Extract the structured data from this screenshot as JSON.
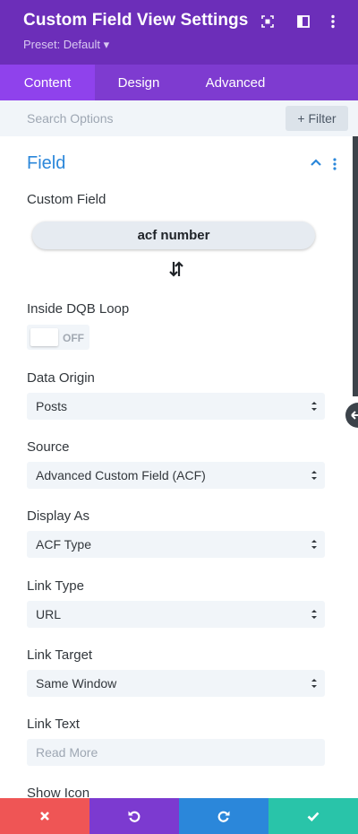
{
  "header": {
    "title": "Custom Field View Settings",
    "preset": "Preset: Default ▾",
    "icons": [
      "fullscreen-icon",
      "sidebar-toggle-icon",
      "more-vertical-icon"
    ]
  },
  "tabs": [
    {
      "label": "Content",
      "active": true
    },
    {
      "label": "Design",
      "active": false
    },
    {
      "label": "Advanced",
      "active": false
    }
  ],
  "search": {
    "placeholder": "Search Options",
    "filter_label": "+ Filter"
  },
  "section": {
    "title": "Field"
  },
  "fields": {
    "custom_field": {
      "label": "Custom Field",
      "value": "acf number"
    },
    "inside_loop": {
      "label": "Inside DQB Loop",
      "state": "OFF"
    },
    "data_origin": {
      "label": "Data Origin",
      "value": "Posts"
    },
    "source": {
      "label": "Source",
      "value": "Advanced Custom Field (ACF)"
    },
    "display_as": {
      "label": "Display As",
      "value": "ACF Type"
    },
    "link_type": {
      "label": "Link Type",
      "value": "URL"
    },
    "link_target": {
      "label": "Link Target",
      "value": "Same Window"
    },
    "link_text": {
      "label": "Link Text",
      "placeholder": "Read More"
    },
    "show_icon": {
      "label": "Show Icon"
    }
  },
  "bottom_bar": [
    {
      "name": "cancel",
      "icon": "close-icon",
      "color": "#ef5555"
    },
    {
      "name": "undo",
      "icon": "undo-icon",
      "color": "#7c3ad0"
    },
    {
      "name": "redo",
      "icon": "redo-icon",
      "color": "#2b87da"
    },
    {
      "name": "save",
      "icon": "check-icon",
      "color": "#29c4a9"
    }
  ],
  "colors": {
    "header": "#6c2eb9",
    "tabs": "#7e3bd0",
    "active_tab": "#8f42ec",
    "accent": "#2b87da"
  }
}
